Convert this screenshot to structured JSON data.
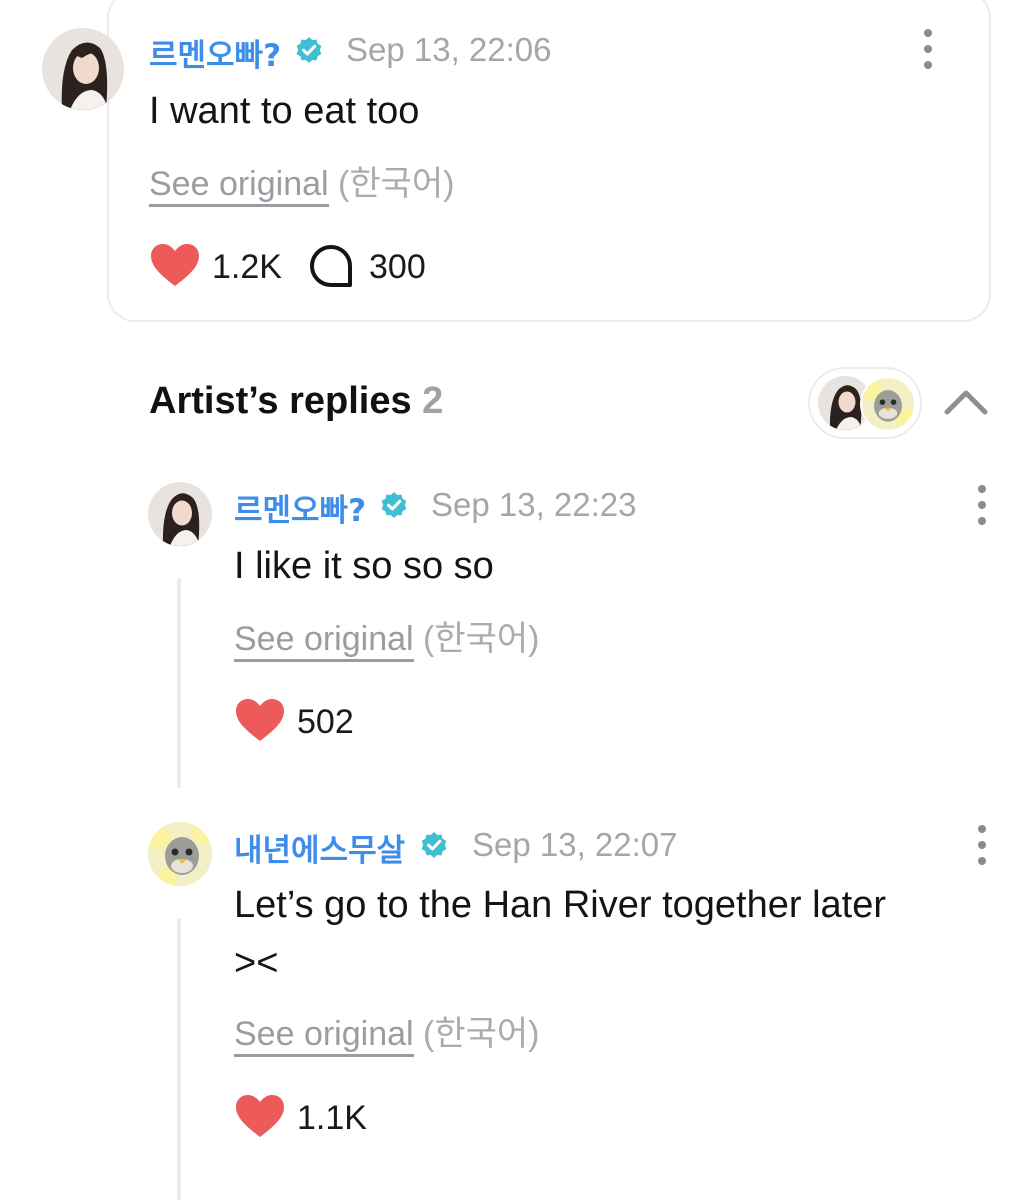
{
  "post": {
    "username": "르멘오빠?",
    "timestamp": "Sep 13, 22:06",
    "text": "I want to eat too",
    "see_original": "See original",
    "language": "(한국어)",
    "likes": "1.2K",
    "comments": "300"
  },
  "replies_section": {
    "title": "Artist’s replies",
    "count": "2"
  },
  "replies": [
    {
      "username": "르멘오빠?",
      "timestamp": "Sep 13, 22:23",
      "text_lines": [
        "I like it so so so"
      ],
      "see_original": "See original",
      "language": "(한국어)",
      "likes": "502"
    },
    {
      "username": "내년에스무살",
      "timestamp": "Sep 13, 22:07",
      "text_lines": [
        "Let’s go to the Han River together later",
        "><"
      ],
      "see_original": "See original",
      "language": "(한국어)",
      "likes": "1.1K"
    }
  ],
  "colors": {
    "username": "#3e8ee9",
    "verified": "#3fbfd3",
    "heart": "#ec5a5a",
    "muted": "#a4a6ab"
  },
  "icons": [
    "verified-badge-icon",
    "heart-icon",
    "comment-bubble-icon",
    "more-options-icon",
    "chevron-up-icon"
  ]
}
